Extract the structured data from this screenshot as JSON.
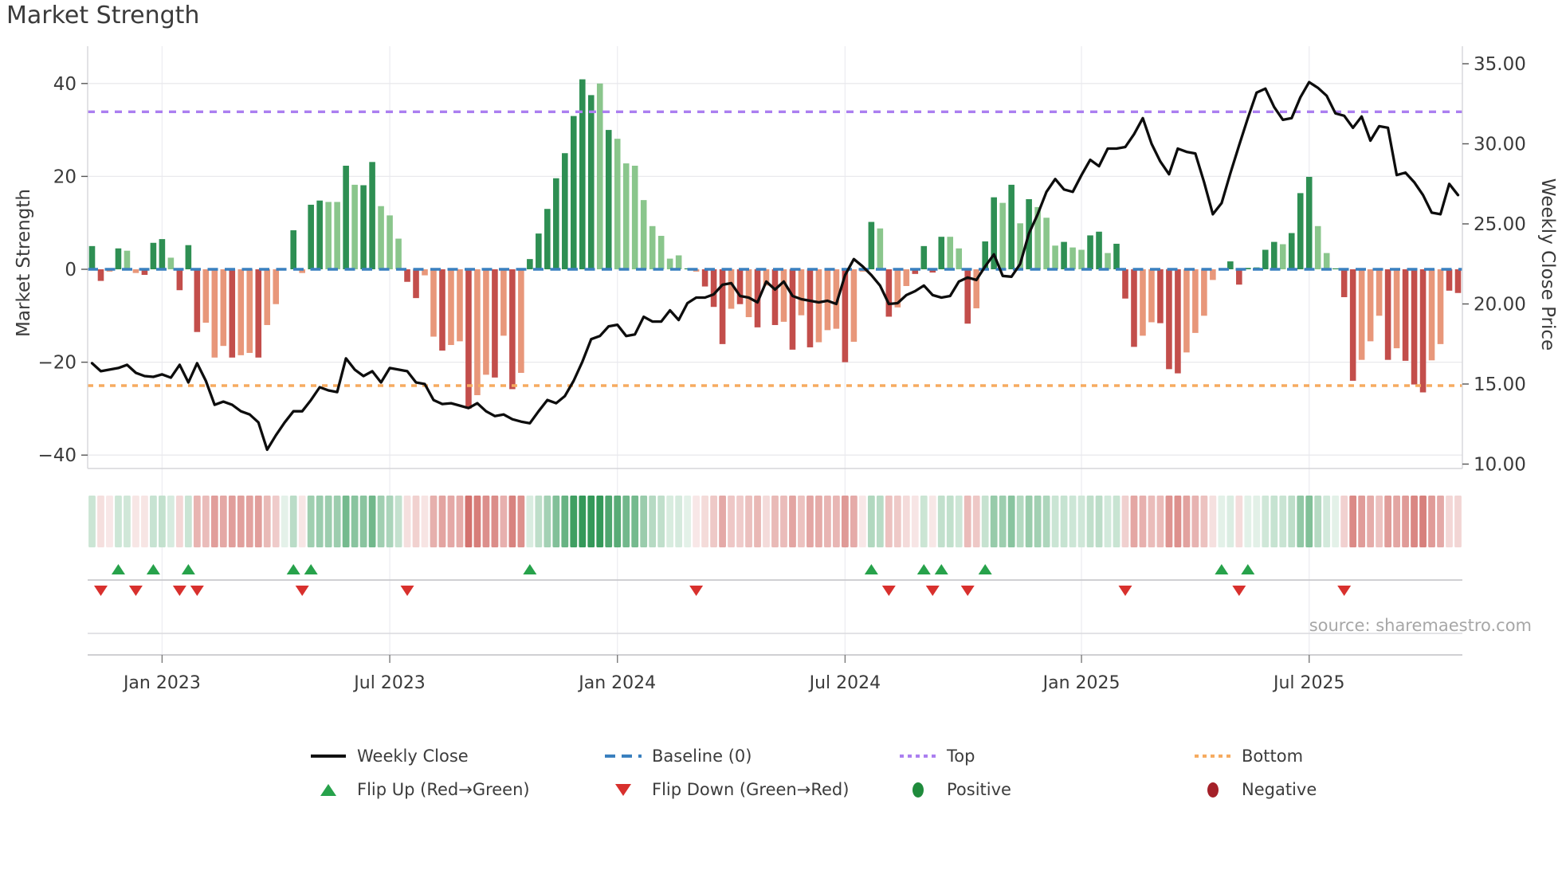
{
  "title": "Market Strength",
  "source_text": "source: sharemaestro.com",
  "legend": {
    "items": [
      {
        "label": "Weekly Close",
        "icon": "black-line-swatch"
      },
      {
        "label": "Baseline (0)",
        "icon": "blue-dashed-swatch"
      },
      {
        "label": "Top",
        "icon": "purple-dotted-swatch"
      },
      {
        "label": "Bottom",
        "icon": "orange-dotted-swatch"
      },
      {
        "label": "Flip Up (Red→Green)",
        "icon": "green-up-triangle"
      },
      {
        "label": "Flip Down (Green→Red)",
        "icon": "red-down-triangle"
      },
      {
        "label": "Positive",
        "icon": "green-circle"
      },
      {
        "label": "Negative",
        "icon": "dark-red-circle"
      }
    ]
  },
  "colors": {
    "bar_green_dark": "#2e8f53",
    "bar_green_light": "#8ac68c",
    "bar_red_dark": "#c34e4b",
    "bar_red_light": "#e8977a",
    "line": "#0d0d0d",
    "baseline": "#3a80bf",
    "top_line": "#ab7ff0",
    "bottom_line": "#f6ab60",
    "flip_up": "#27a24b",
    "flip_down": "#d8302d",
    "grid": "#e9e9ed",
    "vgrid": "#eeeef2",
    "spine": "#d6d6da",
    "tick_text": "#3a3a3a",
    "heat_green": [
      46,
      150,
      84
    ],
    "heat_red": [
      203,
      88,
      83
    ]
  },
  "chart_data": {
    "type": "combo",
    "title": "Market Strength",
    "x_ticks": [
      {
        "label": "Jan 2023",
        "week": 8
      },
      {
        "label": "Jul 2023",
        "week": 34
      },
      {
        "label": "Jan 2024",
        "week": 60
      },
      {
        "label": "Jul 2024",
        "week": 86
      },
      {
        "label": "Jan 2025",
        "week": 113
      },
      {
        "label": "Jul 2025",
        "week": 139
      }
    ],
    "y_left": {
      "label": "Market Strength",
      "ticks": [
        40,
        20,
        0,
        -20,
        -40
      ],
      "tick_labels": [
        "40",
        "20",
        "0",
        "−20",
        "−40"
      ],
      "range": [
        -48,
        48
      ]
    },
    "y_right": {
      "label": "Weekly Close Price",
      "ticks": [
        35,
        30,
        25,
        20,
        15,
        10
      ],
      "tick_labels": [
        "35.00",
        "30.00",
        "25.00",
        "20.00",
        "15.00",
        "10.00"
      ],
      "range": [
        10,
        35
      ]
    },
    "baseline": 0,
    "top_line_price": 32.0,
    "bottom_line_price": 14.9,
    "grid": true,
    "legend_position": "bottom-center",
    "series": [
      {
        "name": "Market Strength",
        "type": "bar",
        "axis": "left",
        "values": [
          5,
          -2.5,
          -0.5,
          4.5,
          4,
          -0.8,
          -1.2,
          5.7,
          6.5,
          2.5,
          -4.5,
          5.2,
          -13.5,
          -11.5,
          -19,
          -16.5,
          -19,
          -18.5,
          -18,
          -19,
          -12,
          -7.5,
          0,
          8.4,
          -0.8,
          13.9,
          14.8,
          14.5,
          14.5,
          22.3,
          18.2,
          18.1,
          23.1,
          13.6,
          11.6,
          6.6,
          -2.7,
          -6.2,
          -1.3,
          -14.5,
          -17.5,
          -16.3,
          -15.5,
          -30,
          -27.1,
          -22.7,
          -23.3,
          -14.3,
          -25.8,
          -22.3,
          2.2,
          7.7,
          13,
          19.6,
          25,
          33,
          40.9,
          37.5,
          40,
          30,
          28.1,
          22.8,
          22.3,
          14.9,
          9.3,
          7.2,
          2.3,
          3,
          0.2,
          -0.5,
          -3.7,
          -8.1,
          -16.1,
          -8.5,
          -7.5,
          -10.3,
          -12.5,
          -3.5,
          -12,
          -11.3,
          -17.3,
          -9.9,
          -16.8,
          -15.7,
          -13.1,
          -12.8,
          -20,
          -15.6,
          -0.5,
          10.2,
          8.8,
          -10.2,
          -8.2,
          -3.6,
          -1,
          5,
          -0.7,
          7,
          7,
          4.5,
          -11.7,
          -8.4,
          6,
          15.5,
          14.3,
          18.2,
          9.9,
          15.1,
          13.4,
          11.1,
          5.1,
          5.9,
          4.7,
          4.2,
          7.3,
          8.1,
          3.5,
          5.5,
          -6.3,
          -16.7,
          -14.3,
          -11.4,
          -11.6,
          -21.5,
          -22.4,
          -17.9,
          -13.7,
          -10,
          -2.3,
          0.2,
          1.7,
          -3.3,
          0.3,
          0.4,
          4.2,
          5.9,
          5.4,
          7.8,
          16.4,
          19.9,
          9.3,
          3.5,
          0.2,
          -6,
          -24,
          -19.5,
          -15.5,
          -10,
          -19.5,
          -17,
          -19.7,
          -24.8,
          -26.5,
          -19.6,
          -16.1,
          -4.6,
          -5.1
        ],
        "light_shade": [
          0,
          0,
          1,
          0,
          1,
          1,
          0,
          0,
          0,
          1,
          0,
          0,
          0,
          1,
          1,
          1,
          0,
          1,
          1,
          0,
          1,
          1,
          0,
          0,
          1,
          0,
          0,
          1,
          1,
          0,
          1,
          0,
          0,
          1,
          1,
          1,
          0,
          0,
          1,
          1,
          0,
          1,
          1,
          0,
          1,
          1,
          0,
          1,
          0,
          1,
          0,
          0,
          0,
          0,
          0,
          0,
          0,
          0,
          1,
          0,
          1,
          1,
          1,
          1,
          1,
          1,
          1,
          1,
          0,
          1,
          0,
          0,
          0,
          1,
          0,
          1,
          0,
          1,
          0,
          1,
          0,
          1,
          0,
          1,
          1,
          1,
          0,
          1,
          1,
          0,
          1,
          0,
          1,
          1,
          0,
          0,
          0,
          0,
          1,
          1,
          0,
          1,
          0,
          0,
          1,
          0,
          1,
          0,
          1,
          1,
          1,
          0,
          1,
          1,
          0,
          0,
          1,
          0,
          0,
          0,
          1,
          1,
          0,
          0,
          0,
          1,
          1,
          1,
          1,
          0,
          0,
          0,
          0,
          0,
          0,
          0,
          1,
          0,
          0,
          0,
          1,
          1,
          0,
          0,
          0,
          1,
          1,
          1,
          0,
          1,
          0,
          0,
          0,
          1,
          1,
          0,
          0
        ]
      },
      {
        "name": "Weekly Close",
        "type": "line",
        "axis": "right",
        "values": [
          16.3,
          15.8,
          15.9,
          16.0,
          16.2,
          15.7,
          15.5,
          15.45,
          15.6,
          15.4,
          16.2,
          15.1,
          16.3,
          15.2,
          13.7,
          13.9,
          13.7,
          13.3,
          13.1,
          12.6,
          10.9,
          11.8,
          12.6,
          13.3,
          13.3,
          14.0,
          14.8,
          14.6,
          14.5,
          16.6,
          15.9,
          15.5,
          15.8,
          15.1,
          16.0,
          15.9,
          15.8,
          15.1,
          15.0,
          14.0,
          13.75,
          13.8,
          13.65,
          13.5,
          13.8,
          13.3,
          13.0,
          13.1,
          12.8,
          12.65,
          12.55,
          13.3,
          14.0,
          13.8,
          14.25,
          15.2,
          16.4,
          17.8,
          18.0,
          18.6,
          18.7,
          18.0,
          18.1,
          19.2,
          18.9,
          18.9,
          19.6,
          19.0,
          20.05,
          20.4,
          20.4,
          20.6,
          21.2,
          21.3,
          20.5,
          20.4,
          20.1,
          21.4,
          20.9,
          21.4,
          20.5,
          20.3,
          20.2,
          20.1,
          20.2,
          20.0,
          21.8,
          22.8,
          22.35,
          21.8,
          21.15,
          20.0,
          20.05,
          20.55,
          20.8,
          21.15,
          20.55,
          20.4,
          20.5,
          21.4,
          21.65,
          21.5,
          22.35,
          23.1,
          21.75,
          21.7,
          22.5,
          24.4,
          25.6,
          27.0,
          27.8,
          27.15,
          27.0,
          28.05,
          29.0,
          28.6,
          29.7,
          29.7,
          29.8,
          30.6,
          31.6,
          30.0,
          28.9,
          28.1,
          29.7,
          29.5,
          29.4,
          27.6,
          25.6,
          26.3,
          28.15,
          29.9,
          31.6,
          33.2,
          33.45,
          32.3,
          31.5,
          31.6,
          32.9,
          33.85,
          33.5,
          33.0,
          31.9,
          31.75,
          31.0,
          31.7,
          30.2,
          31.1,
          31.0,
          28.05,
          28.2,
          27.6,
          26.8,
          25.7,
          25.6,
          27.5,
          26.8
        ]
      }
    ],
    "flip_markers": "derived: up where bar turns positive after non-positive, down where bar turns negative after non-negative",
    "heat_strip": "same weekly values, green=positive red=negative, intensity proportional to magnitude"
  }
}
